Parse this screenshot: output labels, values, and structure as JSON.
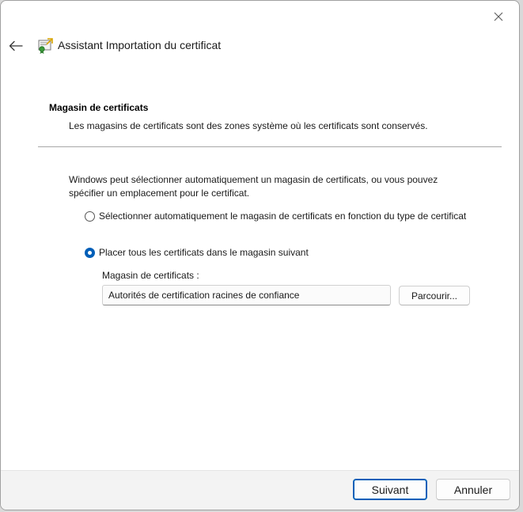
{
  "window": {
    "title": "Assistant Importation du certificat"
  },
  "icons": {
    "close": "close-icon",
    "back": "back-arrow-icon",
    "wizard": "certificate-wizard-icon"
  },
  "header": {
    "section_title": "Magasin de certificats",
    "section_description": "Les magasins de certificats sont des zones système où les certificats sont conservés."
  },
  "main": {
    "intro": "Windows peut sélectionner automatiquement un magasin de certificats, ou vous pouvez spécifier un emplacement pour le certificat.",
    "options": [
      {
        "label": "Sélectionner automatiquement le magasin de certificats en fonction du type de certificat",
        "selected": false
      },
      {
        "label": "Placer tous les certificats dans le magasin suivant",
        "selected": true
      }
    ],
    "store_label": "Magasin de certificats :",
    "store_value": "Autorités de certification racines de confiance",
    "browse_label": "Parcourir..."
  },
  "footer": {
    "next_label": "Suivant",
    "cancel_label": "Annuler"
  },
  "colors": {
    "accent": "#005fb8",
    "footer_bg": "#f3f3f3"
  }
}
